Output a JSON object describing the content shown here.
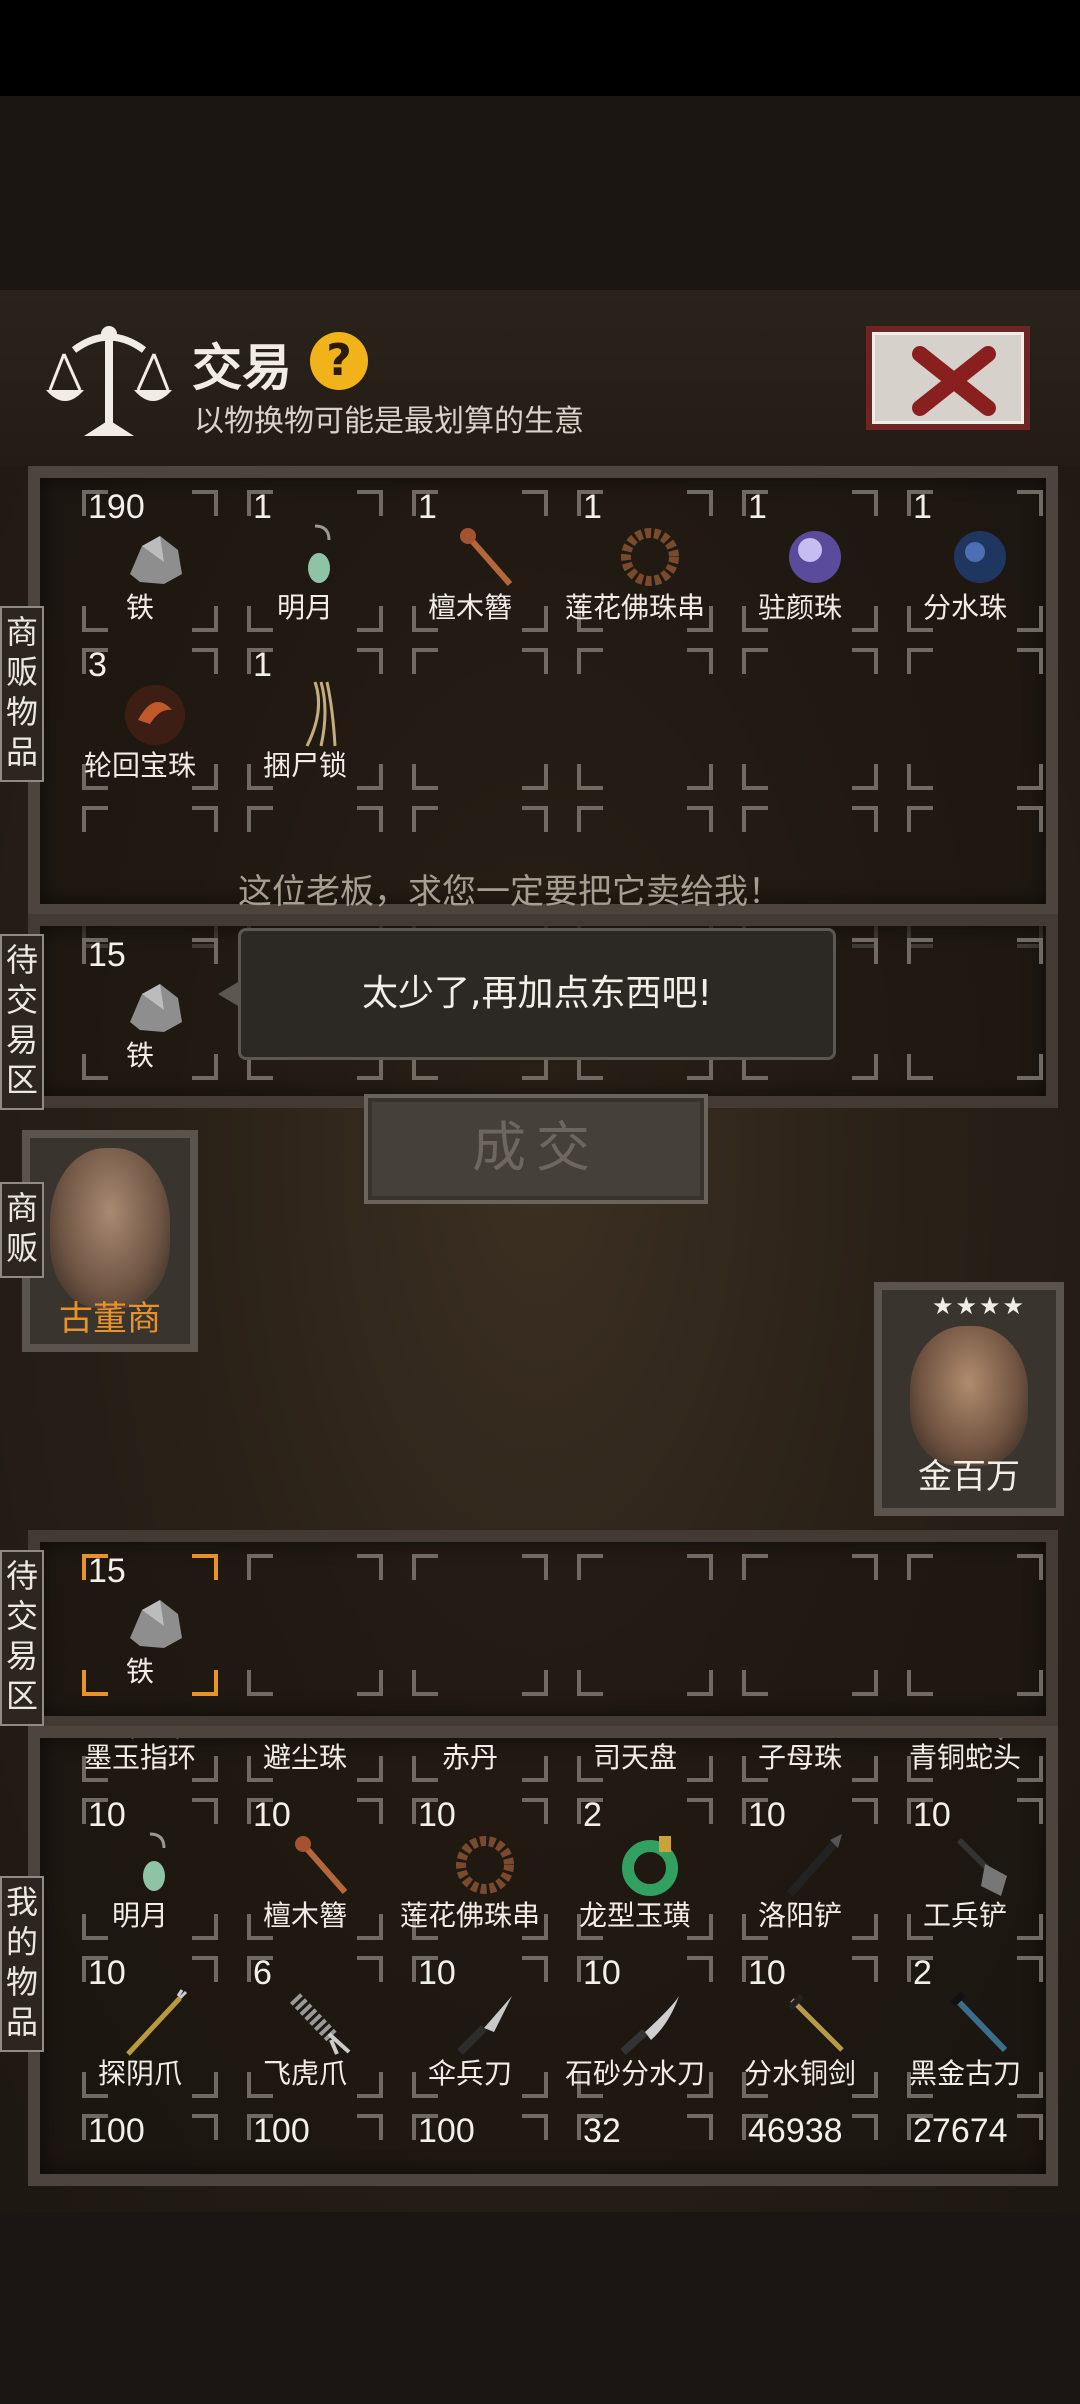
{
  "header": {
    "title": "交易",
    "subtitle": "以物换物可能是最划算的生意",
    "help_symbol": "?"
  },
  "labels": {
    "merchant_goods": "商贩物品",
    "pending_trade": "待交易区",
    "merchant": "商贩",
    "my_items": "我的物品"
  },
  "merchant_items": [
    {
      "qty": "190",
      "name": "铁",
      "icon": "iron-ore-icon"
    },
    {
      "qty": "1",
      "name": "明月",
      "icon": "jade-earring-icon"
    },
    {
      "qty": "1",
      "name": "檀木簪",
      "icon": "wooden-hairpin-icon"
    },
    {
      "qty": "1",
      "name": "莲花佛珠串",
      "icon": "prayer-beads-icon"
    },
    {
      "qty": "1",
      "name": "驻颜珠",
      "icon": "purple-pearl-icon"
    },
    {
      "qty": "1",
      "name": "分水珠",
      "icon": "blue-pearl-icon"
    },
    {
      "qty": "3",
      "name": "轮回宝珠",
      "icon": "red-orb-icon"
    },
    {
      "qty": "1",
      "name": "捆尸锁",
      "icon": "rope-icon"
    }
  ],
  "merchant_pending": [
    {
      "qty": "15",
      "name": "铁",
      "icon": "iron-ore-icon"
    }
  ],
  "merchant_npc": {
    "name": "古董商",
    "speech": "这位老板，求您一定要把它卖给我！",
    "bubble": "太少了,再加点东西吧!"
  },
  "player_npc": {
    "name": "金百万",
    "stars": "★★★★"
  },
  "deal_button": "成交",
  "player_pending": [
    {
      "qty": "15",
      "name": "铁",
      "icon": "iron-ore-icon"
    }
  ],
  "my_items_top_row": [
    {
      "name": "墨玉指环",
      "icon": "jade-ring-icon"
    },
    {
      "name": "避尘珠",
      "icon": "purple-pearl-icon"
    },
    {
      "name": "赤丹",
      "icon": "red-pill-icon"
    },
    {
      "name": "司天盘",
      "icon": "compass-icon"
    },
    {
      "name": "子母珠",
      "icon": "twin-pearl-icon"
    },
    {
      "name": "青铜蛇头",
      "icon": "snake-head-icon"
    }
  ],
  "my_items": [
    {
      "qty": "10",
      "name": "明月",
      "icon": "jade-earring-icon"
    },
    {
      "qty": "10",
      "name": "檀木簪",
      "icon": "wooden-hairpin-icon"
    },
    {
      "qty": "10",
      "name": "莲花佛珠串",
      "icon": "prayer-beads-icon"
    },
    {
      "qty": "2",
      "name": "龙型玉璜",
      "icon": "jade-pendant-icon"
    },
    {
      "qty": "10",
      "name": "洛阳铲",
      "icon": "luoyang-shovel-icon"
    },
    {
      "qty": "10",
      "name": "工兵铲",
      "icon": "shovel-icon"
    },
    {
      "qty": "10",
      "name": "探阴爪",
      "icon": "probe-claw-icon"
    },
    {
      "qty": "6",
      "name": "飞虎爪",
      "icon": "grappling-claw-icon"
    },
    {
      "qty": "10",
      "name": "伞兵刀",
      "icon": "paratrooper-knife-icon"
    },
    {
      "qty": "10",
      "name": "石砂分水刀",
      "icon": "stone-knife-icon"
    },
    {
      "qty": "10",
      "name": "分水铜剑",
      "icon": "bronze-sword-icon"
    },
    {
      "qty": "2",
      "name": "黑金古刀",
      "icon": "black-gold-blade-icon"
    }
  ],
  "my_items_partial_row": [
    "100",
    "100",
    "100",
    "32",
    "46938",
    "27674"
  ],
  "colors": {
    "accent_orange": "#e8922a",
    "help_yellow": "#f2b21a",
    "close_red": "#8a1f1f"
  }
}
